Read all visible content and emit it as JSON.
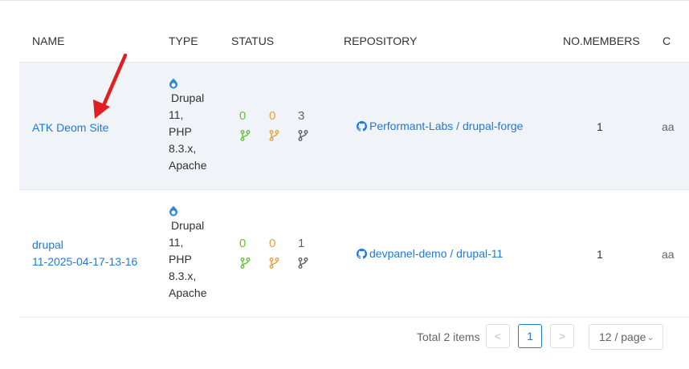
{
  "table": {
    "headers": [
      "NAME",
      "TYPE",
      "STATUS",
      "REPOSITORY",
      "NO.MEMBERS",
      "C"
    ],
    "rows": [
      {
        "name_line1": "ATK Deom Site",
        "name_line2": "",
        "type_lines": [
          "Drupal",
          "11,",
          "PHP",
          "8.3.x,",
          "Apache"
        ],
        "status_green": "0",
        "status_orange": "0",
        "status_gray": "3",
        "repository": "Performant-Labs / drupal-forge",
        "members": "1",
        "cut_text": "aa"
      },
      {
        "name_line1": "drupal",
        "name_line2": "11-2025-04-17-13-16",
        "type_lines": [
          "Drupal",
          "11,",
          "PHP",
          "8.3.x,",
          "Apache"
        ],
        "status_green": "0",
        "status_orange": "0",
        "status_gray": "1",
        "repository": "devpanel-demo / drupal-11",
        "members": "1",
        "cut_text": "aa"
      }
    ]
  },
  "pagination": {
    "total": "Total 2 items",
    "prev": "<",
    "current_page": "1",
    "next": ">",
    "page_size": "12 / page"
  },
  "colors": {
    "link": "#1e7ad9",
    "status_green": "#67c23a",
    "status_orange": "#e6a23c",
    "status_gray": "#606266",
    "arrow": "#e02020",
    "row_highlight": "#f0f4f8"
  },
  "icons": {
    "type": "drupal-icon",
    "status": "git-branch-icon",
    "repository": "github-icon",
    "annotation": "red-arrow"
  }
}
